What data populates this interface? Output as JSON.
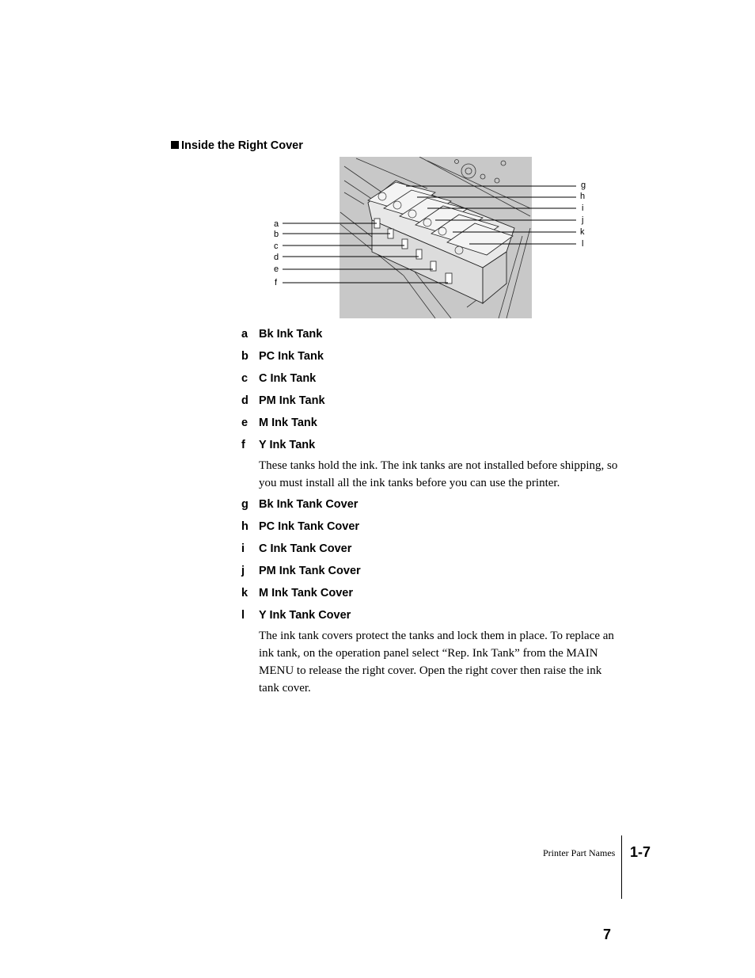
{
  "section": {
    "title": "Inside the Right Cover",
    "bullet_icon": "black-square"
  },
  "figure": {
    "description": "Ink tanks and ink tank covers inside the right cover",
    "left_callouts": [
      "a",
      "b",
      "c",
      "d",
      "e",
      "f"
    ],
    "right_callouts": [
      "g",
      "h",
      "i",
      "j",
      "k",
      "l"
    ]
  },
  "tanks": [
    {
      "letter": "a",
      "label": "Bk Ink Tank"
    },
    {
      "letter": "b",
      "label": "PC Ink Tank"
    },
    {
      "letter": "c",
      "label": "C Ink Tank"
    },
    {
      "letter": "d",
      "label": "PM Ink Tank"
    },
    {
      "letter": "e",
      "label": "M Ink Tank"
    },
    {
      "letter": "f",
      "label": "Y Ink Tank"
    }
  ],
  "tanks_description": "These tanks hold the ink. The ink tanks are not installed before shipping, so you must install all the ink tanks before you can use the printer.",
  "covers": [
    {
      "letter": "g",
      "label": "Bk Ink Tank Cover"
    },
    {
      "letter": "h",
      "label": "PC Ink Tank Cover"
    },
    {
      "letter": "i",
      "label": "C Ink Tank Cover"
    },
    {
      "letter": "j",
      "label": "PM Ink Tank Cover"
    },
    {
      "letter": "k",
      "label": "M Ink Tank Cover"
    },
    {
      "letter": "l",
      "label": "Y Ink Tank Cover"
    }
  ],
  "covers_description": "The ink tank covers protect the tanks and lock them in place. To replace an ink tank, on the operation panel select “Rep. Ink Tank” from the MAIN MENU to release the right cover. Open the right cover then raise the ink tank cover.",
  "footer": {
    "section_name": "Printer Part Names",
    "chapter_page": "1-7",
    "page_number": "7"
  }
}
